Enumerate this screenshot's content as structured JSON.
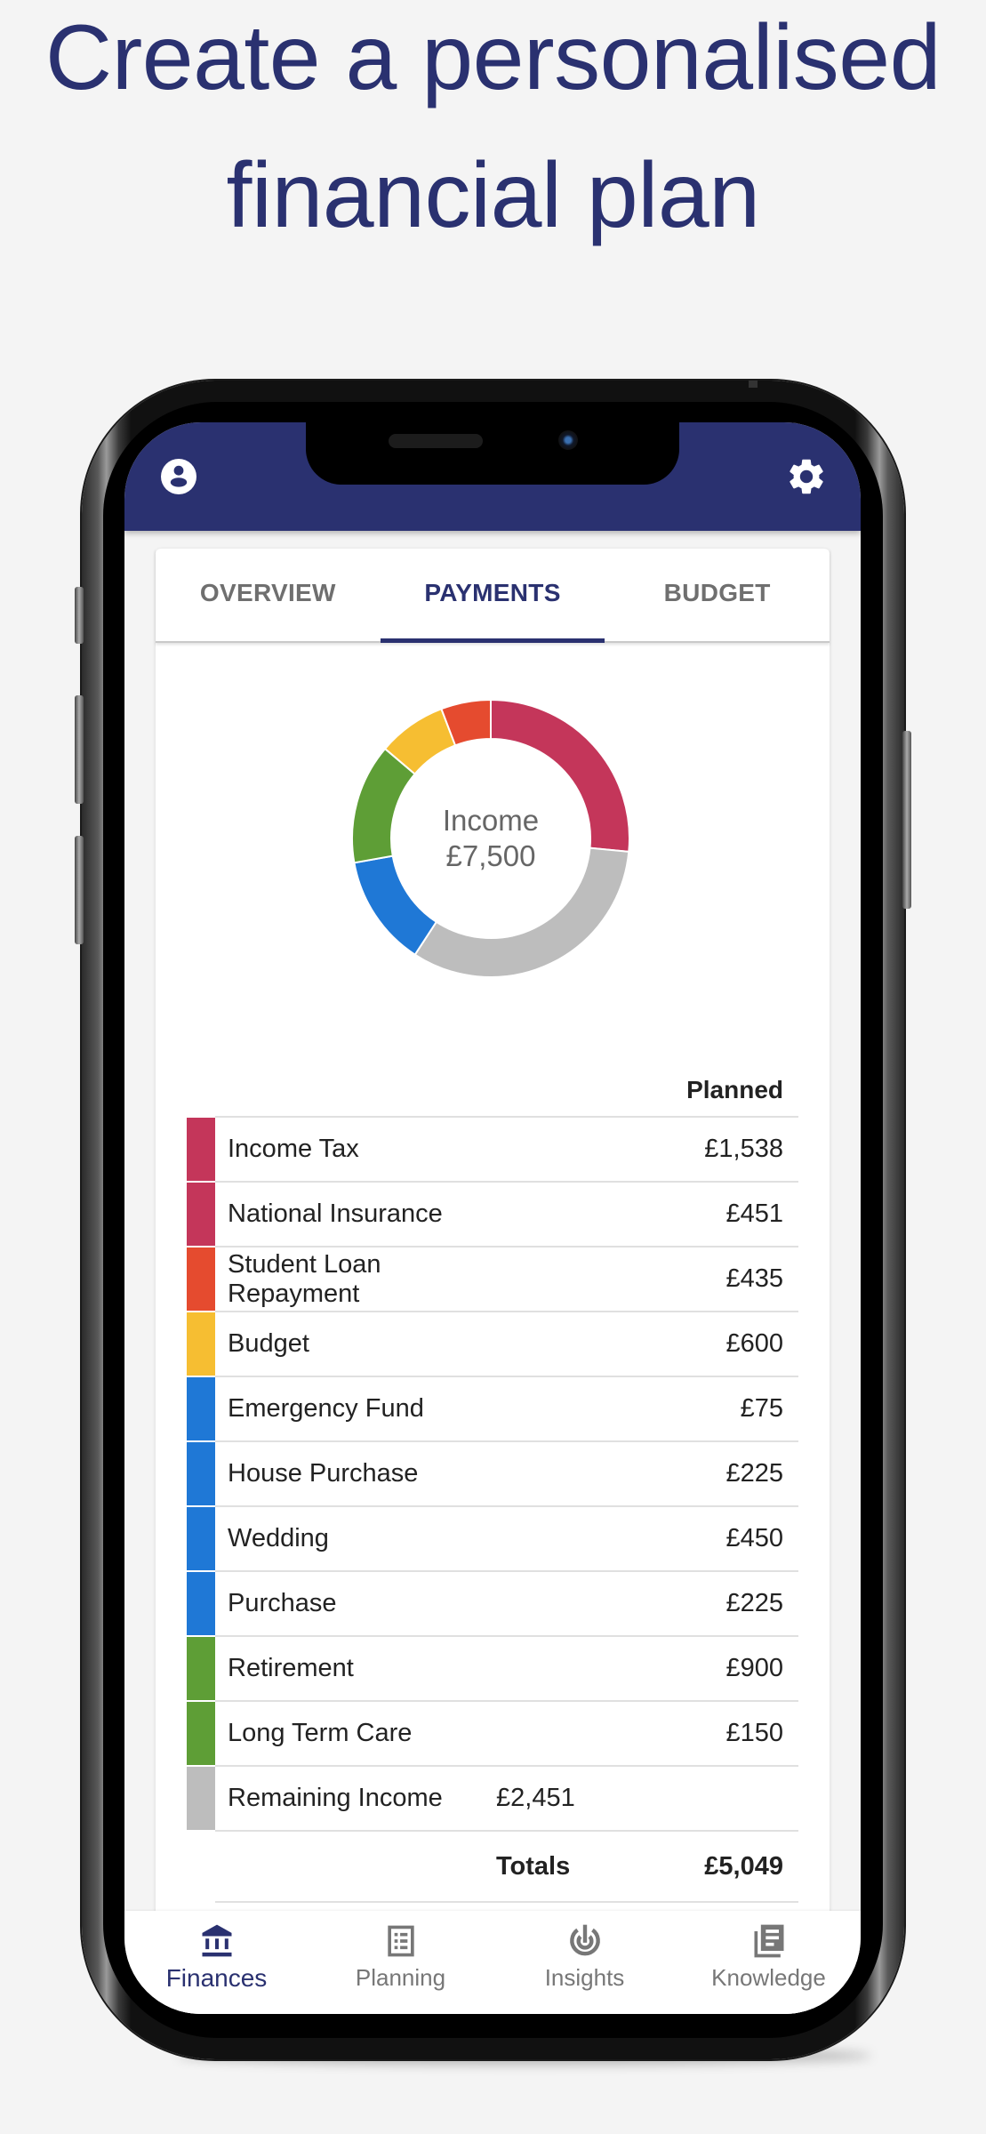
{
  "headline": {
    "line1": "Create a personalised",
    "line2": "financial plan"
  },
  "app": {
    "header": {
      "left_icon": "account-circle-icon",
      "right_icon": "gear-icon"
    },
    "tabs": [
      {
        "label": "OVERVIEW",
        "active": false
      },
      {
        "label": "PAYMENTS",
        "active": true
      },
      {
        "label": "BUDGET",
        "active": false
      }
    ],
    "donut": {
      "center_title": "Income",
      "center_value": "£7,500"
    },
    "table": {
      "column_header": "Planned",
      "rows": [
        {
          "label": "Income Tax",
          "value": "£1,538",
          "color": "#c4365a"
        },
        {
          "label": "National Insurance",
          "value": "£451",
          "color": "#c4365a"
        },
        {
          "label": "Student Loan Repayment",
          "value": "£435",
          "color": "#e54b2f"
        },
        {
          "label": "Budget",
          "value": "£600",
          "color": "#f6be32"
        },
        {
          "label": "Emergency Fund",
          "value": "£75",
          "color": "#1f78d6"
        },
        {
          "label": "House Purchase",
          "value": "£225",
          "color": "#1f78d6"
        },
        {
          "label": "Wedding",
          "value": "£450",
          "color": "#1f78d6"
        },
        {
          "label": "Purchase",
          "value": "£225",
          "color": "#1f78d6"
        },
        {
          "label": "Retirement",
          "value": "£900",
          "color": "#5e9e36"
        },
        {
          "label": "Long Term Care",
          "value": "£150",
          "color": "#5e9e36"
        }
      ],
      "remaining": {
        "label": "Remaining Income",
        "value": "£2,451",
        "color": "#bdbdbd"
      },
      "totals": {
        "label": "Totals",
        "value": "£5,049"
      }
    },
    "bottom_nav": [
      {
        "label": "Finances",
        "icon": "bank-icon",
        "active": true
      },
      {
        "label": "Planning",
        "icon": "list-icon",
        "active": false
      },
      {
        "label": "Insights",
        "icon": "radar-icon",
        "active": false
      },
      {
        "label": "Knowledge",
        "icon": "library-books-icon",
        "active": false
      }
    ],
    "colors": {
      "brand": "#2a3170",
      "tab_inactive": "#6f6f6f"
    }
  },
  "chart_data": {
    "type": "pie",
    "title": "Income £7,500",
    "total": 7500,
    "start": "top",
    "direction": "clockwise",
    "slices": [
      {
        "name": "Taxes (Income Tax + National Insurance)",
        "value": 1989,
        "color": "#c4365a"
      },
      {
        "name": "Remaining Income",
        "value": 2451,
        "color": "#bdbdbd"
      },
      {
        "name": "Savings goals (Emergency Fund, House Purchase, Wedding, Purchase)",
        "value": 975,
        "color": "#1f78d6"
      },
      {
        "name": "Long-term (Retirement, Long Term Care)",
        "value": 1050,
        "color": "#5e9e36"
      },
      {
        "name": "Budget",
        "value": 600,
        "color": "#f6be32"
      },
      {
        "name": "Student Loan Repayment",
        "value": 435,
        "color": "#e54b2f"
      }
    ]
  }
}
